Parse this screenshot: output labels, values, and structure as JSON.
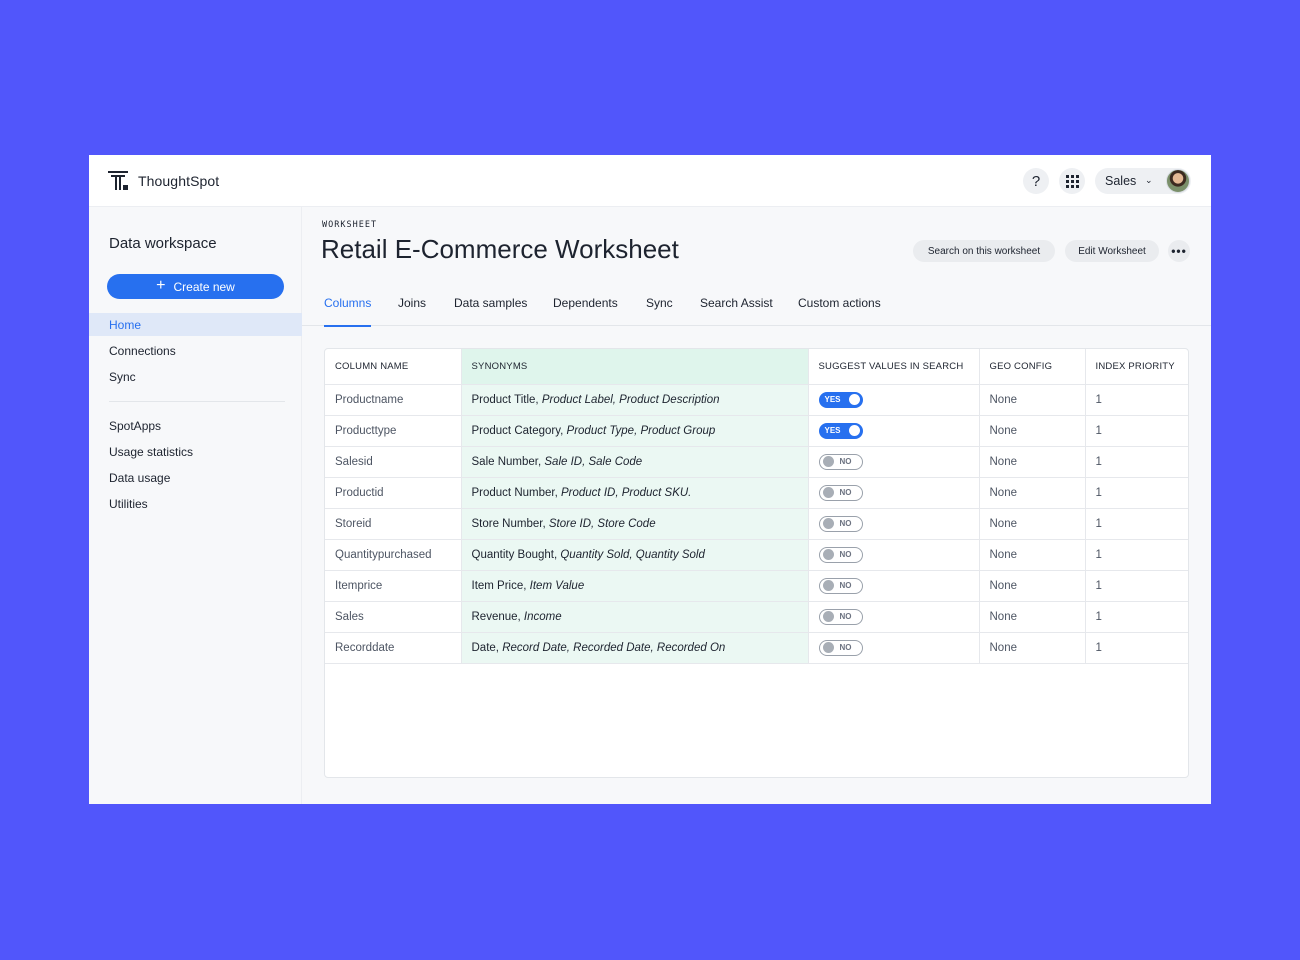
{
  "app": {
    "name": "ThoughtSpot"
  },
  "header": {
    "help_icon": "question-icon",
    "apps_icon": "grid-icon",
    "org": "Sales"
  },
  "sidebar": {
    "title": "Data workspace",
    "create_label": "Create new",
    "items": [
      {
        "label": "Home",
        "active": true
      },
      {
        "label": "Connections"
      },
      {
        "label": "Sync"
      },
      {
        "label": "SpotApps"
      },
      {
        "label": "Usage statistics"
      },
      {
        "label": "Data usage"
      },
      {
        "label": "Utilities"
      }
    ]
  },
  "page": {
    "eyebrow": "WORKSHEET",
    "title": "Retail E-Commerce Worksheet",
    "search_label": "Search on this worksheet",
    "edit_label": "Edit Worksheet",
    "more_label": "•••"
  },
  "tabs": [
    "Columns",
    "Joins",
    "Data samples",
    "Dependents",
    "Sync",
    "Search Assist",
    "Custom actions"
  ],
  "table": {
    "headers": [
      "COLUMN NAME",
      "SYNONYMS",
      "SUGGEST VALUES IN SEARCH",
      "GEO CONFIG",
      "INDEX PRIORITY"
    ],
    "toggle_yes": "YES",
    "toggle_no": "NO",
    "rows": [
      {
        "name": "Productname",
        "syn_main": "Product Title,",
        "syn_extra": " Product Label, Product Description",
        "suggest": true,
        "geo": "None",
        "priority": "1"
      },
      {
        "name": "Producttype",
        "syn_main": "Product Category,",
        "syn_extra": " Product Type, Product Group",
        "suggest": true,
        "geo": "None",
        "priority": "1"
      },
      {
        "name": "Salesid",
        "syn_main": "Sale Number,",
        "syn_extra": " Sale ID, Sale Code",
        "suggest": false,
        "geo": "None",
        "priority": "1"
      },
      {
        "name": "Productid",
        "syn_main": "Product Number,",
        "syn_extra": " Product ID, Product SKU.",
        "suggest": false,
        "geo": "None",
        "priority": "1"
      },
      {
        "name": "Storeid",
        "syn_main": "Store Number,",
        "syn_extra": " Store ID, Store Code",
        "suggest": false,
        "geo": "None",
        "priority": "1"
      },
      {
        "name": "Quantitypurchased",
        "syn_main": "Quantity Bought,",
        "syn_extra": " Quantity Sold, Quantity Sold",
        "suggest": false,
        "geo": "None",
        "priority": "1"
      },
      {
        "name": "Itemprice",
        "syn_main": "Item Price,",
        "syn_extra": " Item Value",
        "suggest": false,
        "geo": "None",
        "priority": "1"
      },
      {
        "name": "Sales",
        "syn_main": "Revenue,",
        "syn_extra": " Income",
        "suggest": false,
        "geo": "None",
        "priority": "1"
      },
      {
        "name": "Recorddate",
        "syn_main": "Date,",
        "syn_extra": " Record Date, Recorded Date, Recorded On",
        "suggest": false,
        "geo": "None",
        "priority": "1"
      }
    ]
  },
  "colors": {
    "background": "#5156fb",
    "accent": "#2770ef",
    "synonym_bg": "#ebf8f3"
  }
}
